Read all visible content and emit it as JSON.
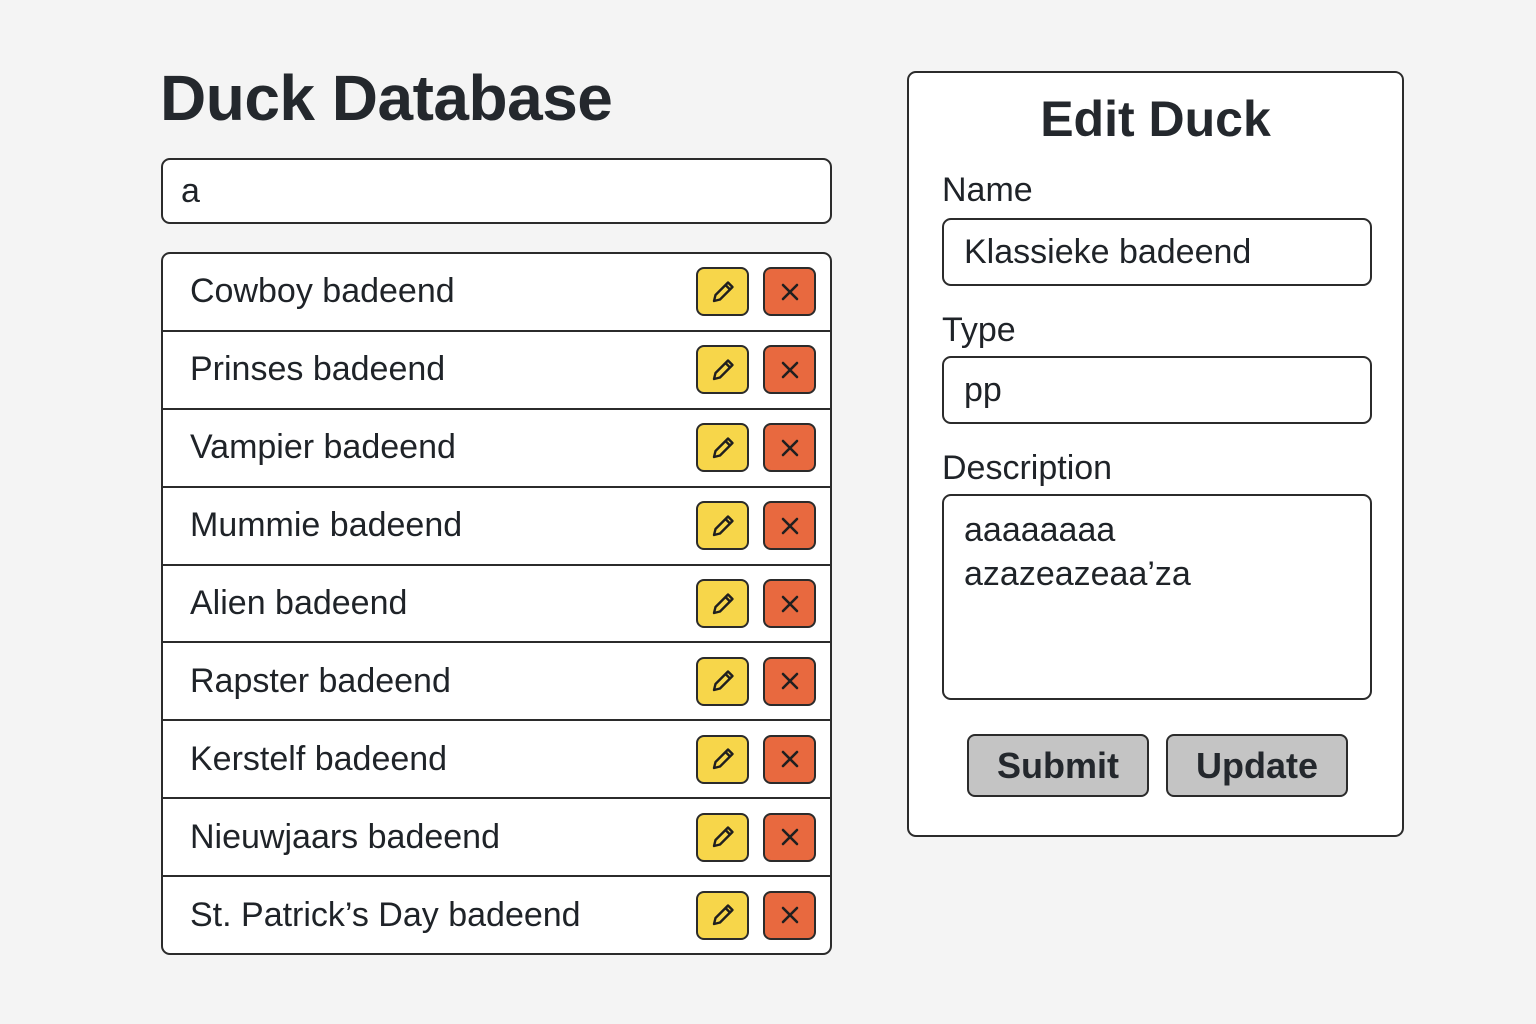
{
  "app": {
    "title": "Duck Database"
  },
  "search": {
    "value": "a"
  },
  "ducks": [
    {
      "name": "Cowboy badeend"
    },
    {
      "name": "Prinses badeend"
    },
    {
      "name": "Vampier badeend"
    },
    {
      "name": "Mummie badeend"
    },
    {
      "name": "Alien badeend"
    },
    {
      "name": "Rapster badeend"
    },
    {
      "name": "Kerstelf badeend"
    },
    {
      "name": "Nieuwjaars badeend"
    },
    {
      "name": "St. Patrick’s Day badeend"
    }
  ],
  "row_actions": {
    "edit_icon": "pencil-icon",
    "delete_icon": "close-icon"
  },
  "colors": {
    "edit_button": "#f7d64a",
    "delete_button": "#e8693f",
    "action_button": "#c4c4c4",
    "border": "#2b2b2b"
  },
  "edit_form": {
    "title": "Edit Duck",
    "name_label": "Name",
    "name_value": "Klassieke badeend",
    "type_label": "Type",
    "type_value": "pp",
    "description_label": "Description",
    "description_value": "aaaaaaaa\nazazeazeaa’za",
    "submit_label": "Submit",
    "update_label": "Update"
  }
}
